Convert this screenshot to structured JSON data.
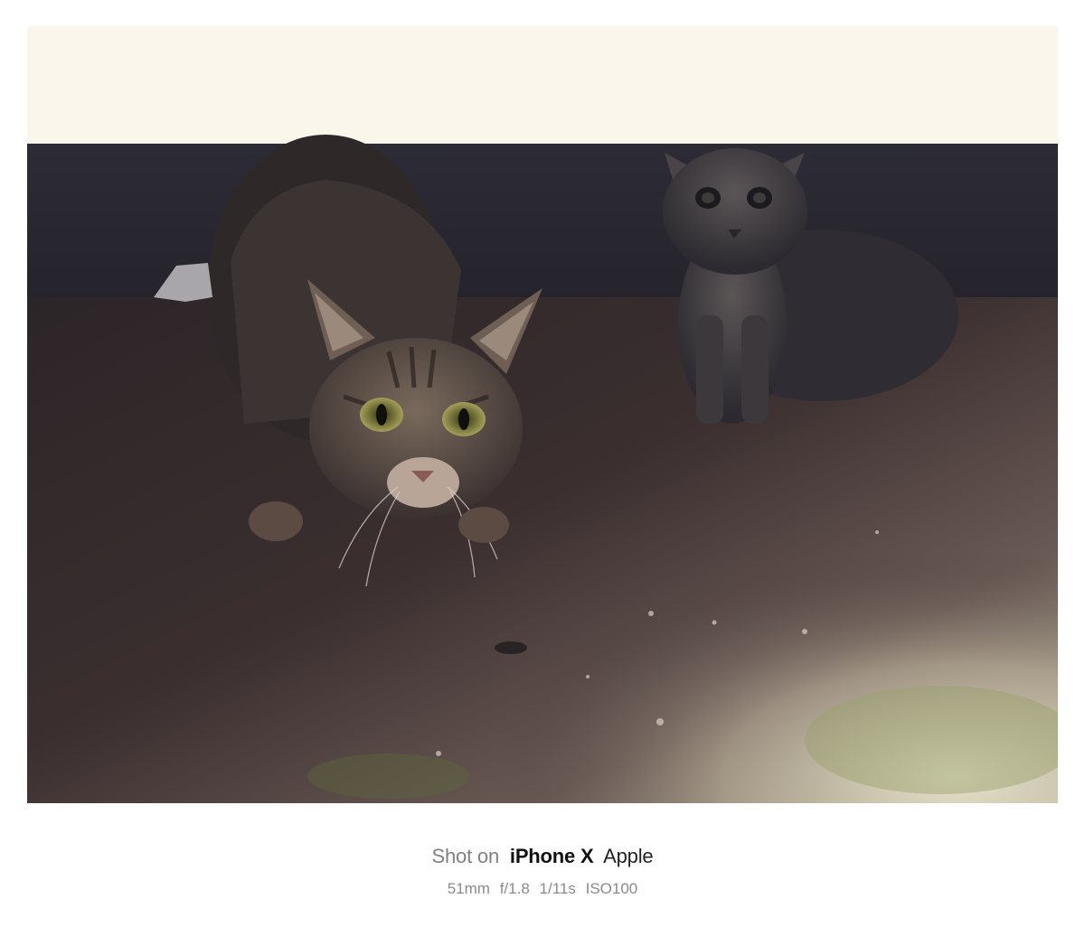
{
  "photo": {
    "subject": "two-tabby-cats-under-ledge"
  },
  "caption": {
    "shot_on": "Shot on",
    "model": "iPhone X",
    "brand": "Apple"
  },
  "exif": {
    "focal_length": "51mm",
    "aperture": "f/1.8",
    "shutter": "1/11s",
    "iso": "ISO100"
  }
}
